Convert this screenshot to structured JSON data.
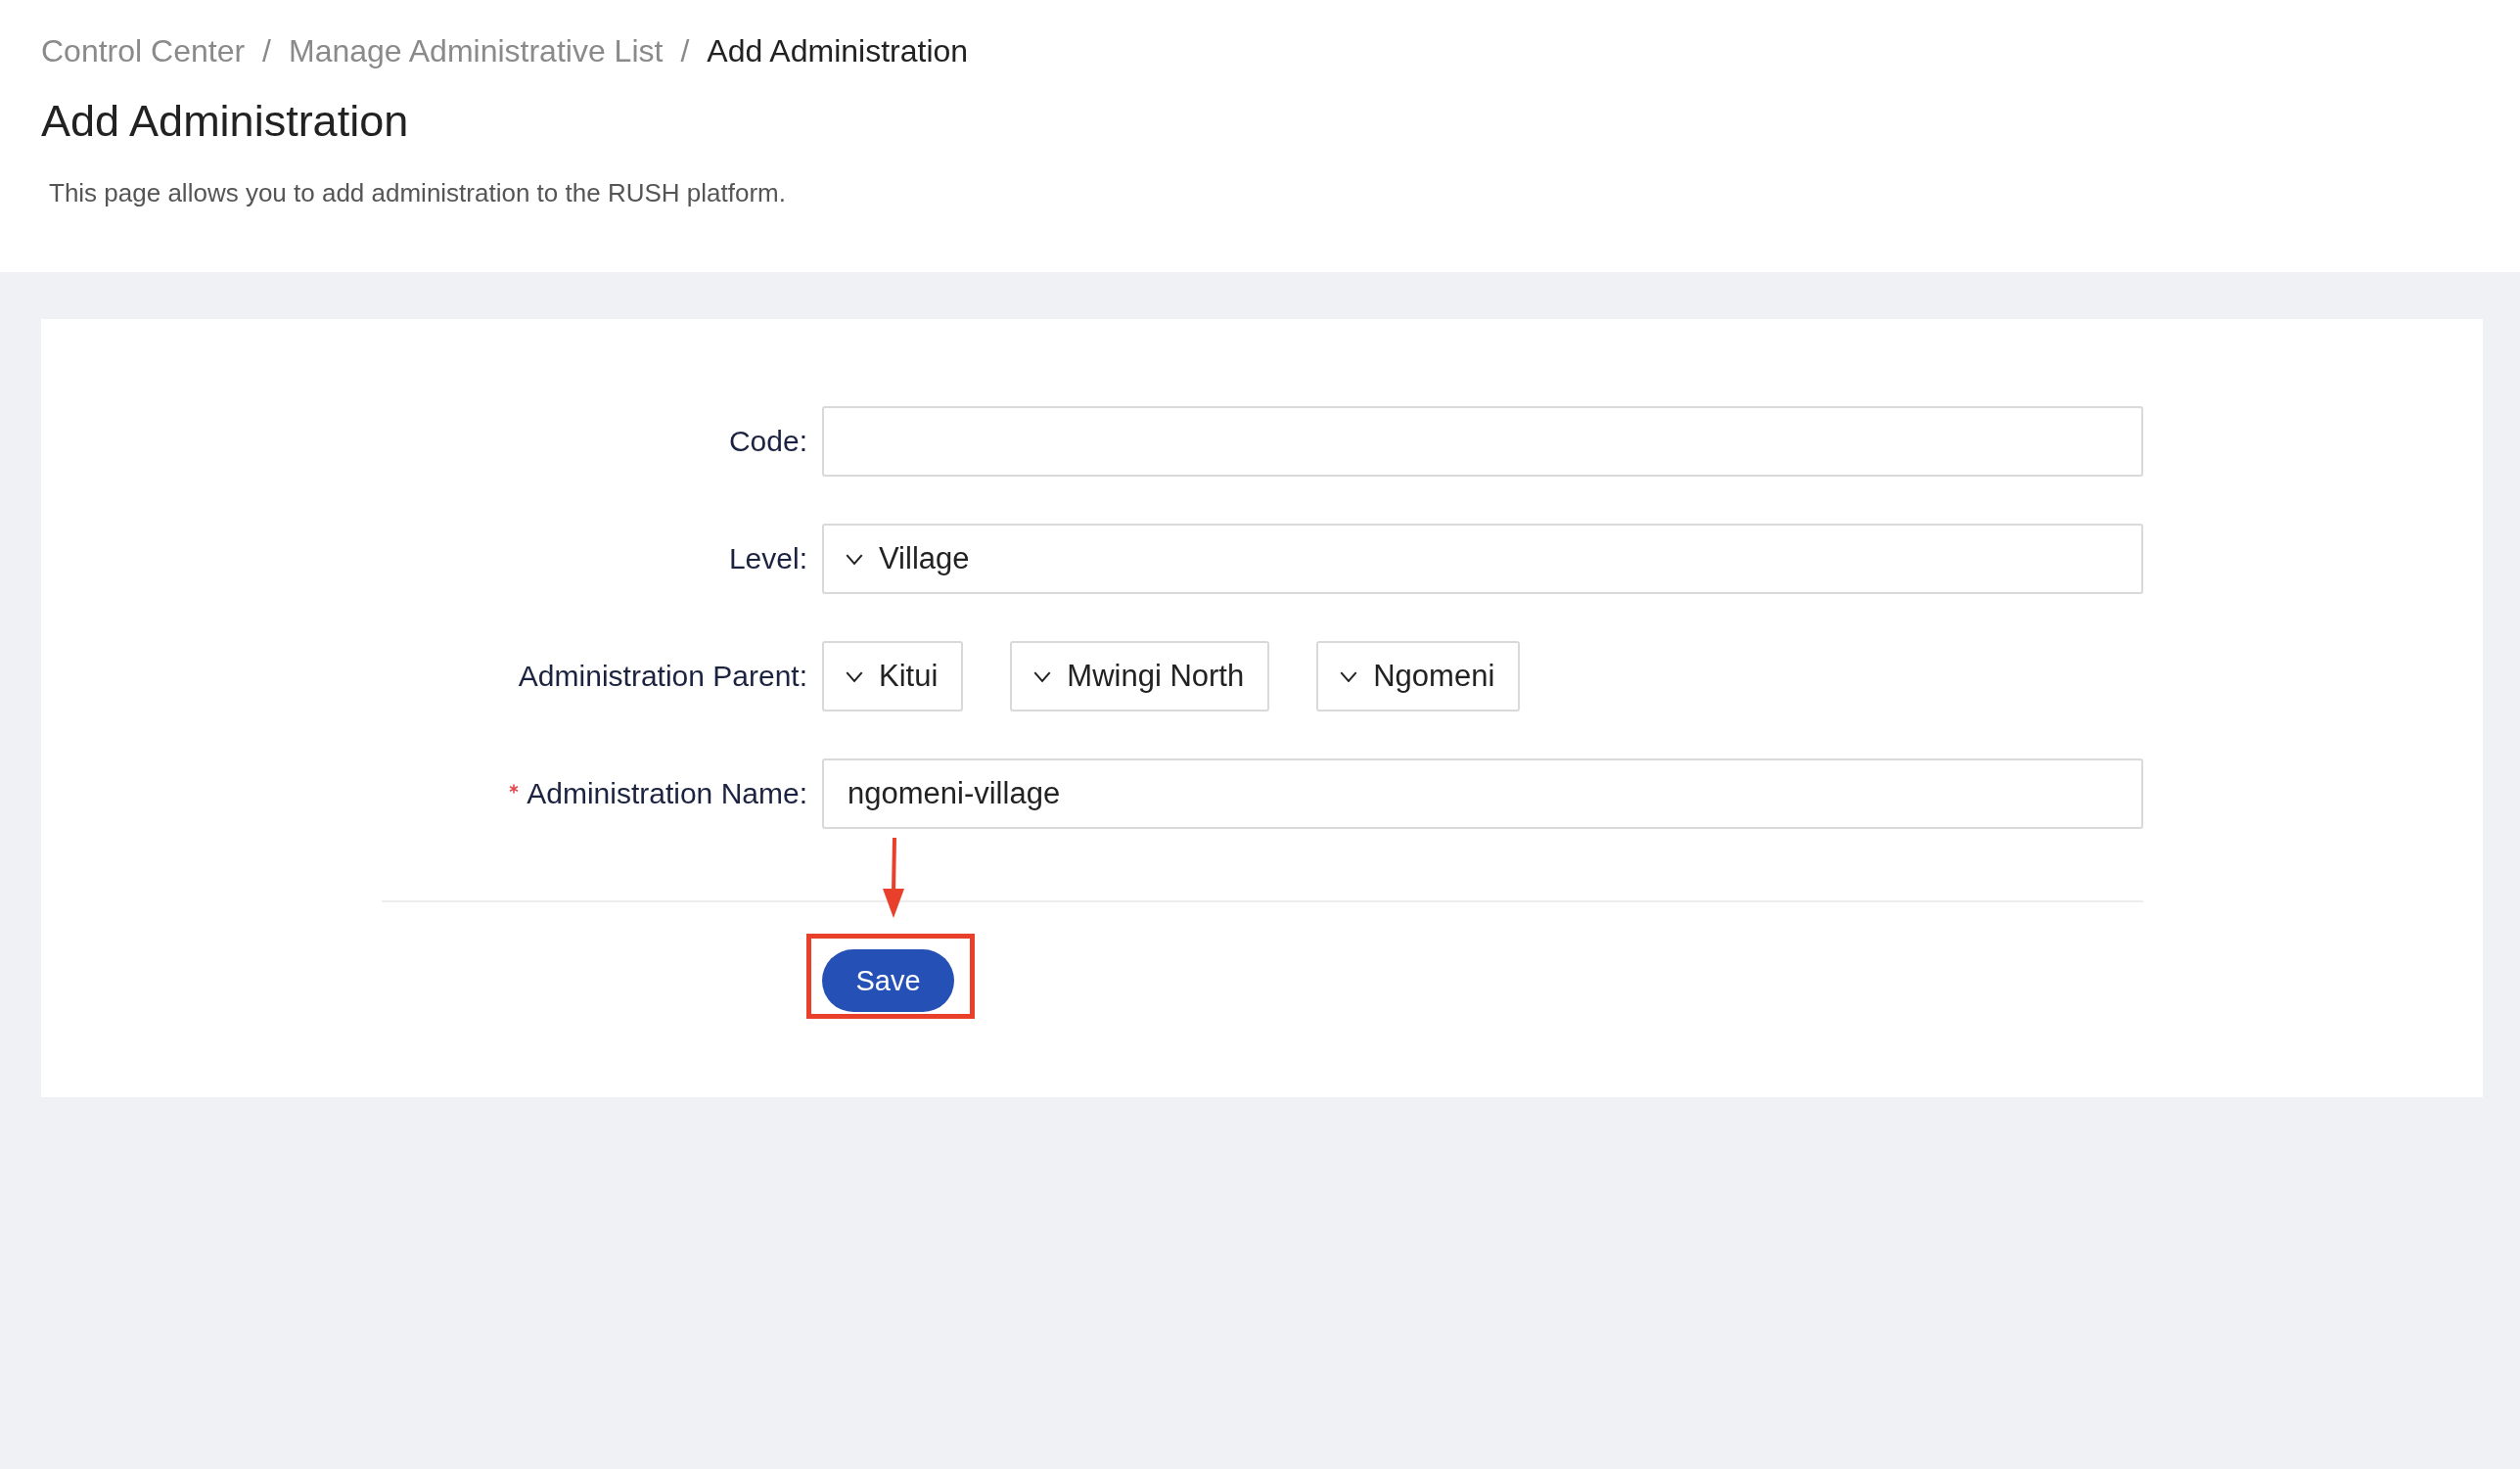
{
  "breadcrumb": [
    {
      "label": "Control Center",
      "current": false
    },
    {
      "label": "Manage Administrative List",
      "current": false
    },
    {
      "label": "Add Administration",
      "current": true
    }
  ],
  "breadcrumb_separator": "/",
  "title": "Add Administration",
  "description": "This page allows you to add administration to the RUSH platform.",
  "form": {
    "fields": [
      {
        "kind": "text",
        "label": "Code:",
        "required": false
      },
      {
        "kind": "select",
        "label": "Level:",
        "required": false,
        "value": "Village"
      },
      {
        "kind": "multi-select",
        "label": "Administration Parent:",
        "required": false,
        "values": [
          "Kitui",
          "Mwingi North",
          "Ngomeni"
        ]
      },
      {
        "kind": "text",
        "label": "Administration Name:",
        "required": true,
        "value": "ngomeni-village"
      }
    ],
    "save_button": {
      "label": "Save",
      "highlighted": true
    }
  }
}
